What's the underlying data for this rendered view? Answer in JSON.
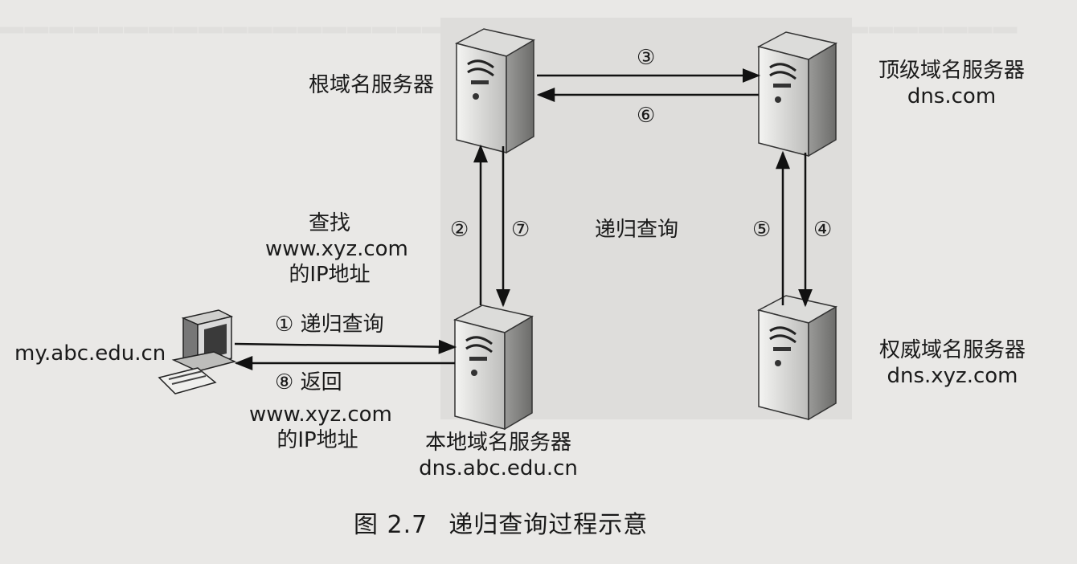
{
  "servers": {
    "root": {
      "name": "根域名服务器"
    },
    "tld": {
      "name": "顶级域名服务器",
      "domain": "dns.com"
    },
    "auth": {
      "name": "权威域名服务器",
      "domain": "dns.xyz.com"
    },
    "local": {
      "name": "本地域名服务器",
      "domain": "dns.abc.edu.cn"
    }
  },
  "client": {
    "host": "my.abc.edu.cn"
  },
  "steps": {
    "s1": "① 递归查询",
    "s2": "②",
    "s3": "③",
    "s4": "④",
    "s5": "⑤",
    "s6": "⑥",
    "s7": "⑦",
    "s8": "⑧ 返回"
  },
  "query": {
    "line1": "查找",
    "line2": "www.xyz.com",
    "line3": "的IP地址"
  },
  "reply": {
    "line1": "www.xyz.com",
    "line2": "的IP地址"
  },
  "center_label": "递归查询",
  "caption": {
    "number": "图 2.7",
    "title": "递归查询过程示意"
  }
}
